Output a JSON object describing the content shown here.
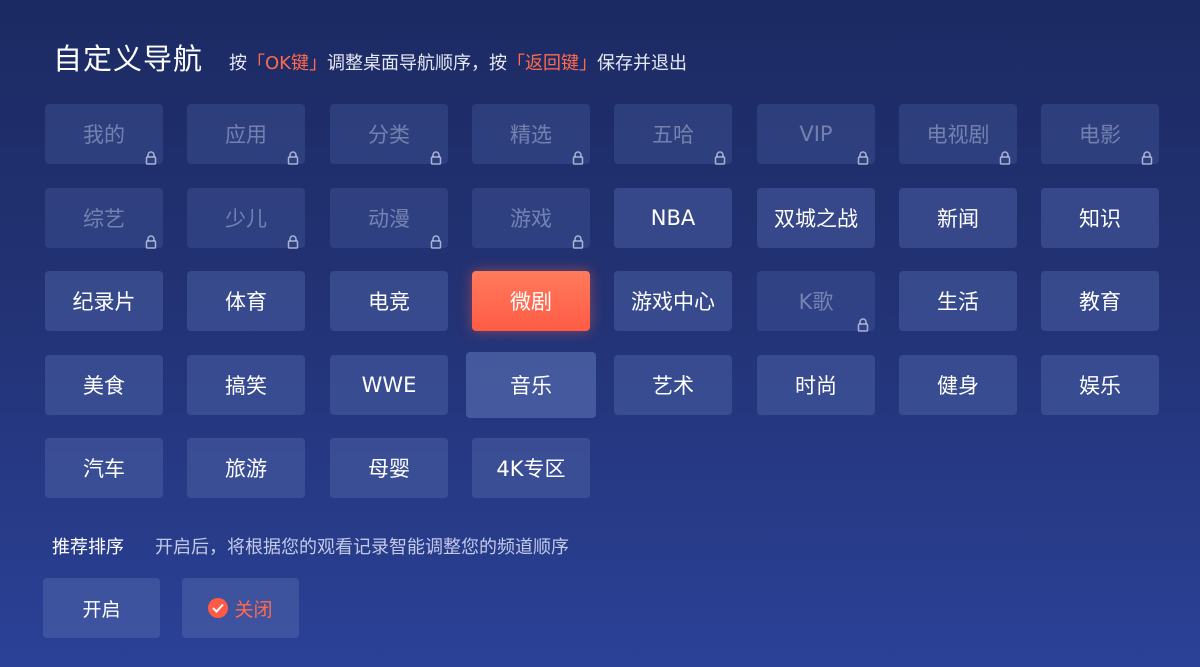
{
  "header": {
    "title": "自定义导航",
    "hint_pre": "按",
    "bracket_open": "「",
    "bracket_close": "」",
    "ok_key": "OK键",
    "hint_mid": "调整桌面导航顺序，按",
    "back_key": "返回键",
    "hint_post": "保存并退出"
  },
  "tiles": [
    {
      "label": "我的",
      "locked": true
    },
    {
      "label": "应用",
      "locked": true
    },
    {
      "label": "分类",
      "locked": true
    },
    {
      "label": "精选",
      "locked": true
    },
    {
      "label": "五哈",
      "locked": true
    },
    {
      "label": "VIP",
      "locked": true
    },
    {
      "label": "电视剧",
      "locked": true
    },
    {
      "label": "电影",
      "locked": true
    },
    {
      "label": "综艺",
      "locked": true
    },
    {
      "label": "少儿",
      "locked": true
    },
    {
      "label": "动漫",
      "locked": true
    },
    {
      "label": "游戏",
      "locked": true
    },
    {
      "label": "NBA",
      "locked": false
    },
    {
      "label": "双城之战",
      "locked": false
    },
    {
      "label": "新闻",
      "locked": false
    },
    {
      "label": "知识",
      "locked": false
    },
    {
      "label": "纪录片",
      "locked": false
    },
    {
      "label": "体育",
      "locked": false
    },
    {
      "label": "电竞",
      "locked": false
    },
    {
      "label": "微剧",
      "locked": false,
      "focused": true
    },
    {
      "label": "游戏中心",
      "locked": false
    },
    {
      "label": "K歌",
      "locked": true
    },
    {
      "label": "生活",
      "locked": false
    },
    {
      "label": "教育",
      "locked": false
    },
    {
      "label": "美食",
      "locked": false
    },
    {
      "label": "搞笑",
      "locked": false
    },
    {
      "label": "WWE",
      "locked": false
    },
    {
      "label": "音乐",
      "locked": false,
      "raised": true
    },
    {
      "label": "艺术",
      "locked": false
    },
    {
      "label": "时尚",
      "locked": false
    },
    {
      "label": "健身",
      "locked": false
    },
    {
      "label": "娱乐",
      "locked": false
    },
    {
      "label": "汽车",
      "locked": false
    },
    {
      "label": "旅游",
      "locked": false
    },
    {
      "label": "母婴",
      "locked": false
    },
    {
      "label": "4K专区",
      "locked": false
    }
  ],
  "recommend": {
    "label": "推荐排序",
    "description": "开启后，将根据您的观看记录智能调整您的频道顺序",
    "on_label": "开启",
    "off_label": "关闭",
    "selected": "关闭"
  },
  "colors": {
    "accent": "#ff6a4d",
    "tile": "#4f64a8",
    "background_top": "#1c2a63",
    "background_bottom": "#2b4197"
  },
  "icons": {
    "lock": "lock-icon",
    "check": "check-icon"
  }
}
